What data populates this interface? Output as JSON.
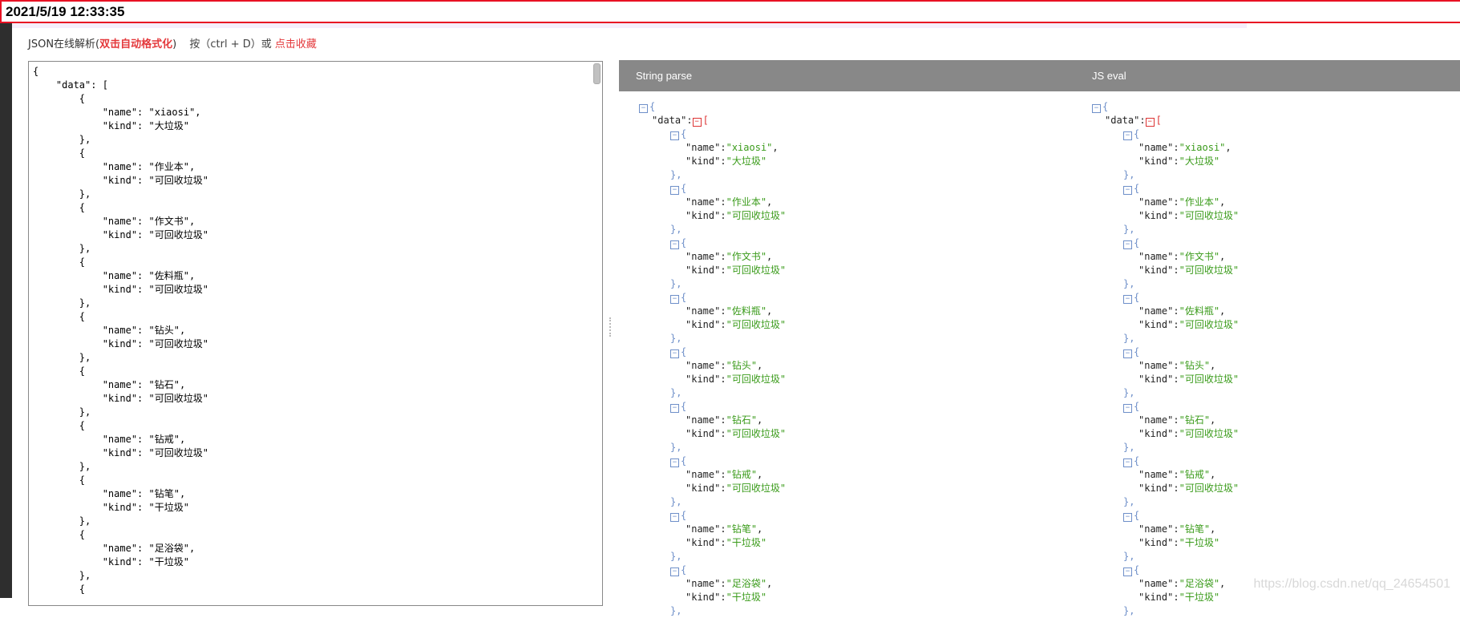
{
  "datetime": "2021/5/19 12:33:35",
  "toolbar": {
    "title": "JSON在线解析(",
    "highlight": "双击自动格式化",
    "close": ")",
    "hint": "按（ctrl + D）或 ",
    "bookmark": "点击收藏"
  },
  "editor_text": "{\n    \"data\": [\n        {\n            \"name\": \"xiaosi\",\n            \"kind\": \"大垃圾\"\n        },\n        {\n            \"name\": \"作业本\",\n            \"kind\": \"可回收垃圾\"\n        },\n        {\n            \"name\": \"作文书\",\n            \"kind\": \"可回收垃圾\"\n        },\n        {\n            \"name\": \"佐料瓶\",\n            \"kind\": \"可回收垃圾\"\n        },\n        {\n            \"name\": \"钻头\",\n            \"kind\": \"可回收垃圾\"\n        },\n        {\n            \"name\": \"钻石\",\n            \"kind\": \"可回收垃圾\"\n        },\n        {\n            \"name\": \"钻戒\",\n            \"kind\": \"可回收垃圾\"\n        },\n        {\n            \"name\": \"钻笔\",\n            \"kind\": \"干垃圾\"\n        },\n        {\n            \"name\": \"足浴袋\",\n            \"kind\": \"干垃圾\"\n        },\n        {",
  "panels": {
    "string_parse": "String parse",
    "js_eval": "JS eval"
  },
  "tree": {
    "root_key": "\"data\"",
    "items": [
      {
        "name": "xiaosi",
        "kind": "大垃圾"
      },
      {
        "name": "作业本",
        "kind": "可回收垃圾"
      },
      {
        "name": "作文书",
        "kind": "可回收垃圾"
      },
      {
        "name": "佐料瓶",
        "kind": "可回收垃圾"
      },
      {
        "name": "钻头",
        "kind": "可回收垃圾"
      },
      {
        "name": "钻石",
        "kind": "可回收垃圾"
      },
      {
        "name": "钻戒",
        "kind": "可回收垃圾"
      },
      {
        "name": "钻笔",
        "kind": "干垃圾"
      },
      {
        "name": "足浴袋",
        "kind": "干垃圾"
      }
    ]
  },
  "watermark": "https://blog.csdn.net/qq_24654501"
}
